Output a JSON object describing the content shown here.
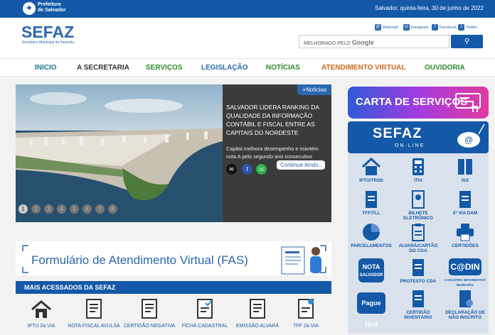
{
  "topbar": {
    "logo_line1": "Prefeitura",
    "logo_line2": "de Salvador",
    "date": "Salvador, quinta-feira, 30 de junho de 2022"
  },
  "header": {
    "logo": "SEFAZ",
    "subtitle": "Secretaria Municipal da Fazenda",
    "social": {
      "webmail": "Webmail",
      "instagram": "Instagram",
      "facebook": "Facebook",
      "twitter": "Twitter"
    },
    "search_label": "MELHORADO PELO",
    "search_brand": "Google"
  },
  "nav": [
    {
      "label": "INICIO",
      "color": "#1f7a8c"
    },
    {
      "label": "A SECRETARIA",
      "color": "#333333"
    },
    {
      "label": "SERVIÇOS",
      "color": "#2e8b2e"
    },
    {
      "label": "LEGISLAÇÃO",
      "color": "#2b67b1"
    },
    {
      "label": "NOTÍCIAS",
      "color": "#2e8b2e"
    },
    {
      "label": "ATENDIMENTO VIRTUAL",
      "color": "#d2691e"
    },
    {
      "label": "OUVIDORIA",
      "color": "#2e8b2e"
    }
  ],
  "hero": {
    "tag": "+Notícias",
    "title": "SALVADOR LIDERA RANKING DA QUALIDADE DA INFORMAÇÃO CONTÁBIL E FISCAL ENTRE AS CAPITAIS DO NORDESTE",
    "subtitle": "Capital melhora desempenho e mantém nota A pelo segundo ano consecutivo",
    "more": "Continue lendo..",
    "dots": [
      "1",
      "2",
      "3",
      "4",
      "5",
      "6",
      "7",
      "8"
    ]
  },
  "fas": {
    "title": "Formulário de Atendimento Virtual (FAS)"
  },
  "mais": {
    "title": "MAIS ACESSADOS DA SEFAZ",
    "items": [
      "IPTU 2a VIA",
      "NOTA FISCAL AVULSA",
      "CERTIDÃO NEGATIVA",
      "FICHA CADASTRAL",
      "EMISSÃO ALVARÁ",
      "TFF 2a VIA"
    ]
  },
  "sidebar": {
    "carta": "CARTA DE SERVIÇOS",
    "online_title": "SEFAZ",
    "online_sub": "ON-LINE",
    "services": [
      {
        "l1": "IPTU/TRSD",
        "l2": ""
      },
      {
        "l1": "ITIV",
        "l2": ""
      },
      {
        "l1": "ISS",
        "l2": ""
      },
      {
        "l1": "TFF/TLL",
        "l2": ""
      },
      {
        "l1": "BILHETE",
        "l2": "ELETRÔNICO"
      },
      {
        "l1": "2ª VIA DAM",
        "l2": ""
      },
      {
        "l1": "PARCELAMENTOS",
        "l2": ""
      },
      {
        "l1": "ALVARÁ/CARTÃO",
        "l2": "DO CGA"
      },
      {
        "l1": "CERTIDÕES",
        "l2": ""
      },
      {
        "l1": "NOTA",
        "l2": "SALVADOR"
      },
      {
        "l1": "PROTESTO CDA",
        "l2": ""
      },
      {
        "l1": "C@DIN",
        "l2": "CADASTRO INFORMATIVO MUNICIPAL"
      },
      {
        "l1": "Pague fácil",
        "l2": ""
      },
      {
        "l1": "CERTIDÃO",
        "l2": "INVENTÁRIO"
      },
      {
        "l1": "DECLARAÇÃO DE",
        "l2": "NÃO INSCRITO"
      }
    ]
  }
}
